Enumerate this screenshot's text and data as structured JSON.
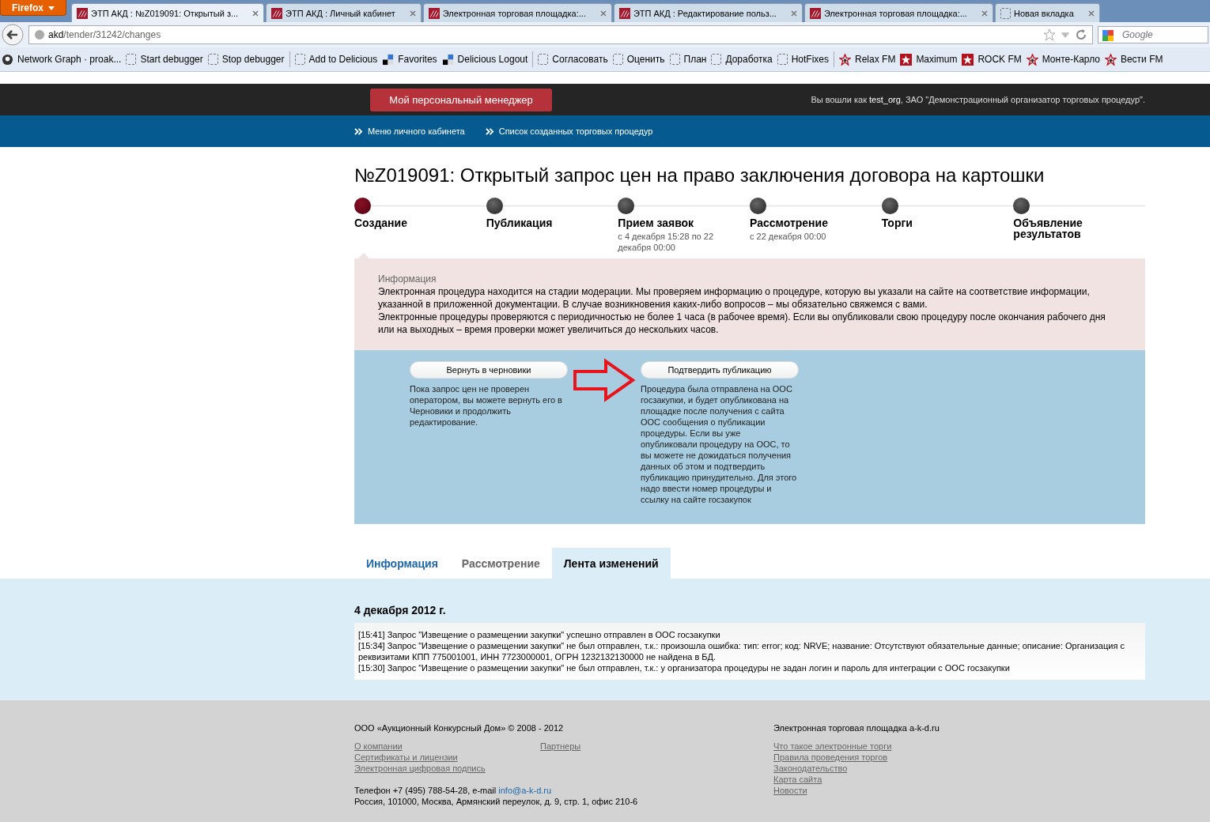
{
  "browser": {
    "app_button": "Firefox",
    "tabs": [
      {
        "title": "ЭТП АКД : №Z019091: Открытый з...",
        "selected": true,
        "kind": "site"
      },
      {
        "title": "ЭТП АКД : Личный кабинет",
        "selected": false,
        "kind": "site"
      },
      {
        "title": "Электронная торговая площадка:...",
        "selected": false,
        "kind": "site"
      },
      {
        "title": "ЭТП АКД : Редактирование польз...",
        "selected": false,
        "kind": "site"
      },
      {
        "title": "Электронная торговая площадка:...",
        "selected": false,
        "kind": "site"
      },
      {
        "title": "Новая вкладка",
        "selected": false,
        "kind": "blank"
      }
    ],
    "address_host": "akd",
    "address_path": "/tender/31242/changes",
    "search_placeholder": "Google",
    "bookmarks": [
      {
        "label": "Network Graph · proak...",
        "kind": "github"
      },
      {
        "label": "Start debugger",
        "kind": "blank"
      },
      {
        "label": "Stop debugger",
        "kind": "blank"
      },
      {
        "label": "Add to Delicious",
        "kind": "blank",
        "sep_before": true
      },
      {
        "label": "Favorites",
        "kind": "delicious"
      },
      {
        "label": "Delicious Logout",
        "kind": "delicious"
      },
      {
        "label": "Согласовать",
        "kind": "blank",
        "sep_before": true
      },
      {
        "label": "Оценить",
        "kind": "blank"
      },
      {
        "label": "План",
        "kind": "blank"
      },
      {
        "label": "Доработка",
        "kind": "blank"
      },
      {
        "label": "HotFixes",
        "kind": "blank"
      },
      {
        "label": "Relax FM",
        "kind": "radio",
        "sep_before": true
      },
      {
        "label": "Maximum",
        "kind": "star"
      },
      {
        "label": "ROCK FM",
        "kind": "star"
      },
      {
        "label": "Монте-Карло",
        "kind": "radio"
      },
      {
        "label": "Вести FM",
        "kind": "radio"
      }
    ]
  },
  "header": {
    "manager_button": "Мой персональный менеджер",
    "login_prefix": "Вы вошли как",
    "login_user": "test_org",
    "login_org": ", ЗАО \"Демонстрационный организатор торговых процедур\"."
  },
  "breadcrumbs": [
    "Меню личного кабинета",
    "Список созданных торговых процедур"
  ],
  "title": "№Z019091: Открытый запрос цен на право заключения договора на картошки",
  "steps": [
    {
      "name": "Создание",
      "selected": true
    },
    {
      "name": "Публикация",
      "selected": false
    },
    {
      "name": "Прием заявок",
      "date": "с 4 декабря 15:28 по 22 декабря 00:00",
      "selected": false
    },
    {
      "name": "Рассмотрение",
      "date": "с 22 декабря 00:00",
      "selected": false
    },
    {
      "name": "Торги",
      "selected": false
    },
    {
      "name": "Объявление результатов",
      "selected": false
    }
  ],
  "info": {
    "heading": "Информация",
    "paragraphs": [
      "Электронная процедура находится на стадии модерации. Мы проверяем информацию о процедуре, которую вы указали на сайте на соответствие информации, указанной в приложенной документации. В случае возникновения каких-либо вопросов – мы обязательно свяжемся с вами.",
      "Электронные процедуры проверяются с периодичностью не более 1 часа (в рабочее время). Если вы опубликовали свою процедуру после окончания рабочего дня или на выходных – время проверки может увеличиться до нескольких часов."
    ]
  },
  "actions": [
    {
      "button": "Вернуть в черновики",
      "text": "Пока запрос цен не проверен оператором, вы можете вернуть его в Черновики и продолжить редактирование."
    },
    {
      "button": "Подтвердить публикацию",
      "text": "Процедура была отправлена на ООС госзакупки, и будет опубликована на площадке после получения с сайта ООС сообщения о публикации процедуры. Если вы уже опубликовали процедуру на ООС, то вы можете не дожидаться получения данных об этом и подтвердить публикацию принудительно. Для этого надо ввести номер процедуры и ссылку на сайте госзакупок"
    }
  ],
  "tabs": [
    {
      "label": "Информация",
      "selected": false,
      "disabled": false
    },
    {
      "label": "Рассмотрение",
      "selected": false,
      "disabled": true
    },
    {
      "label": "Лента изменений",
      "selected": true,
      "disabled": false
    }
  ],
  "log": {
    "date": "4 декабря 2012 г.",
    "entries": [
      "[15:41] Запрос \"Извещение о размещении закупки\" успешно отправлен в ООС госзакупки",
      "[15:34] Запрос \"Извещение о размещении закупки\" не был отправлен, т.к.: произошла ошибка: тип: error; код: NRVE; название: Отсутствуют обязательные данные; описание: Организация с реквизитами КПП 775001001, ИНН 7723000001, ОГРН 1232132130000 не найдена в БД.",
      "[15:30] Запрос \"Извещение о размещении закупки\" не был отправлен, т.к.: у организатора процедуры не задан логин и пароль для интеграции с ООС госзакупки"
    ]
  },
  "footer": {
    "company": "ООО «Аукционный Конкурсный Дом» © 2008 - 2012",
    "links_left": [
      "О компании",
      "Сертификаты и лицензии",
      "Электронная цифровая подпись"
    ],
    "links_middle": [
      "Партнеры"
    ],
    "phone": "Телефон +7 (495) 788-54-28, e-mail",
    "email": "info@a-k-d.ru",
    "address": "Россия, 101000, Москва, Армянский переулок, д. 9, стр. 1, офис 210-6",
    "right_title": "Электронная торговая площадка a-k-d.ru",
    "links_right": [
      "Что такое электронные торги",
      "Правила проведения торгов",
      "Законодательство",
      "Карта сайта",
      "Новости"
    ]
  }
}
